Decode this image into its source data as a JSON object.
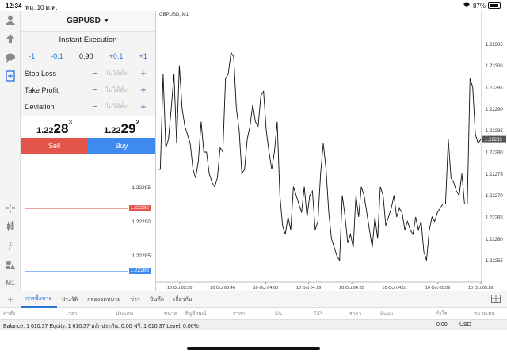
{
  "status_bar": {
    "time": "12:34",
    "date": "พฤ. 10 ต.ค.",
    "battery": "87%"
  },
  "toolrail": {
    "icons": [
      "quotes-icon",
      "trade-icon",
      "chat-icon",
      "new-order-icon",
      "crosshair-icon",
      "candles-icon",
      "indicator-icon",
      "objects-icon"
    ],
    "timeframe": "M1"
  },
  "order": {
    "symbol": "GBPUSD",
    "execution": "Instant Execution",
    "volume_steps": [
      "-1",
      "-0.1",
      "+0.1",
      "+1"
    ],
    "volume": "0.90",
    "params": [
      {
        "label": "Stop Loss",
        "value": "ไม่ได้ตั้ง"
      },
      {
        "label": "Take Profit",
        "value": "ไม่ได้ตั้ง"
      },
      {
        "label": "Deviation",
        "value": "ไม่ได้ตั้ง"
      }
    ],
    "bid": {
      "small": "1.22",
      "big": "28",
      "sup": "3"
    },
    "ask": {
      "small": "1.22",
      "big": "29",
      "sup": "2"
    },
    "sell_label": "Sell",
    "buy_label": "Buy"
  },
  "depth": {
    "levels": [
      "1.22295",
      "1.22290",
      "1.22285"
    ],
    "ask_tag": "1.22292",
    "bid_tag": "1.22283",
    "ask_color": "#e25548",
    "bid_color": "#3f8af0"
  },
  "chart_data": {
    "type": "line",
    "title": "GBPUSD, M1",
    "ylim": [
      1.2225,
      1.2231
    ],
    "y_ticks": [
      "1.22305",
      "1.22300",
      "1.22295",
      "1.22290",
      "1.22285",
      "1.22280",
      "1.22275",
      "1.22270",
      "1.22265",
      "1.22260",
      "1.22255"
    ],
    "x_ticks": [
      "10 Oct 03:30",
      "10 Oct 03:46",
      "10 Oct 04:03",
      "10 Oct 04:19",
      "10 Oct 04:35",
      "10 Oct 04:51",
      "10 Oct 05:09",
      "10 Oct 05:26"
    ],
    "current_price": "1.22283",
    "current_price_value": 1.22283,
    "values": [
      1.22276,
      1.22276,
      1.22298,
      1.22281,
      1.22283,
      1.2229,
      1.22298,
      1.22282,
      1.223,
      1.2229,
      1.22286,
      1.22284,
      1.22282,
      1.22276,
      1.22274,
      1.22278,
      1.22287,
      1.2228,
      1.2228,
      1.22275,
      1.22273,
      1.22272,
      1.22274,
      1.22281,
      1.2228,
      1.22297,
      1.22298,
      1.22303,
      1.22302,
      1.2229,
      1.22285,
      1.22275,
      1.22276,
      1.22283,
      1.22286,
      1.22291,
      1.22287,
      1.22286,
      1.22293,
      1.22294,
      1.22285,
      1.2228,
      1.22276,
      1.2228,
      1.22287,
      1.2227,
      1.22263,
      1.22261,
      1.22265,
      1.22262,
      1.22272,
      1.2227,
      1.22268,
      1.22266,
      1.22272,
      1.22265,
      1.2227,
      1.22271,
      1.22262,
      1.22264,
      1.22275,
      1.22282,
      1.22276,
      1.22266,
      1.2226,
      1.22258,
      1.22256,
      1.22255,
      1.2227,
      1.22265,
      1.22259,
      1.22261,
      1.22258,
      1.2227,
      1.22265,
      1.22272,
      1.2227,
      1.22266,
      1.22262,
      1.22258,
      1.22265,
      1.2226,
      1.22272,
      1.2227,
      1.22263,
      1.22265,
      1.22267,
      1.2227,
      1.22265,
      1.22267,
      1.22266,
      1.22262,
      1.22264,
      1.22262,
      1.22261,
      1.22265,
      1.22262,
      1.22264,
      1.22257,
      1.22255,
      1.22262,
      1.22265,
      1.22264,
      1.22266,
      1.22267,
      1.22268,
      1.22268,
      1.22283,
      1.22274,
      1.22273,
      1.22271,
      1.2227,
      1.22275,
      1.22268,
      1.22268,
      1.22297,
      1.22295,
      1.22284,
      1.22282,
      1.22283
    ]
  },
  "tabs": [
    "การซื้อขาย",
    "ประวัติ",
    "กล่องจดหมาย",
    "ข่าว",
    "บันทึก",
    "เกี่ยวกับ"
  ],
  "columns": [
    "คำสั่ง",
    "เวลา",
    "ประเภท",
    "ขนาด",
    "สัญลักษณ์",
    "ราคา",
    "S/L",
    "T/P",
    "ราคา",
    "Swap",
    "กำไร",
    "หมายเหตุ"
  ],
  "balance": {
    "text": "Balance: 1 610.37 Equity: 1 610.37 หลักประกัน: 0.00 ฟรี: 1 610.37 Level: 0.00%",
    "total": "0.00",
    "currency": "USD"
  }
}
